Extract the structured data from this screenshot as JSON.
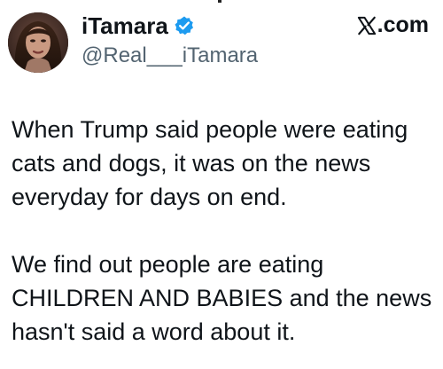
{
  "author": {
    "display_name": "iTamara",
    "handle": "@Real___iTamara",
    "verified_icon": "verified-badge-icon",
    "avatar_icon": "profile-photo"
  },
  "brand": {
    "label": ".com",
    "logo_icon": "x-logo-icon"
  },
  "tweet": {
    "paragraphs": [
      "When Trump said people were eating cats and dogs, it was on the news everyday for days on end.",
      "We find out people are eating CHILDREN AND BABIES and the news hasn't said a word about it."
    ]
  },
  "colors": {
    "text": "#0f1419",
    "secondary_text": "#536471",
    "verified_blue": "#1d9bf0",
    "background": "#ffffff"
  }
}
